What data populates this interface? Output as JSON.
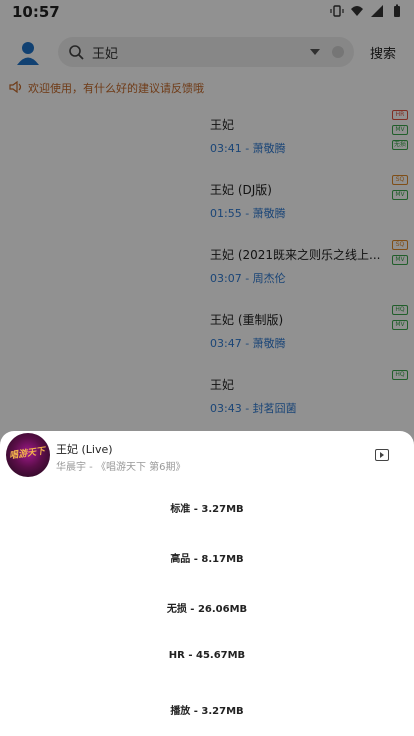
{
  "status": {
    "time": "10:57"
  },
  "header": {
    "search_value": "王妃",
    "search_button": "搜索"
  },
  "notice": {
    "text": "欢迎使用，有什么好的建议请反馈哦"
  },
  "songs": [
    {
      "title": "王妃",
      "subtitle": "03:41 - 萧敬腾",
      "badges": [
        {
          "label": "HR",
          "color": "#e0523f"
        },
        {
          "label": "MV",
          "color": "#3aa64c"
        },
        {
          "label": "无损",
          "color": "#3aa64c"
        }
      ]
    },
    {
      "title": "王妃 (DJ版)",
      "subtitle": "01:55 - 萧敬腾",
      "badges": [
        {
          "label": "SQ",
          "color": "#e08a2a"
        },
        {
          "label": "MV",
          "color": "#3aa64c"
        }
      ]
    },
    {
      "title": "王妃 (2021既来之则乐之线上...",
      "subtitle": "03:07 - 周杰伦",
      "badges": [
        {
          "label": "SQ",
          "color": "#e08a2a"
        },
        {
          "label": "MV",
          "color": "#3aa64c"
        }
      ]
    },
    {
      "title": "王妃 (重制版)",
      "subtitle": "03:47 - 萧敬腾",
      "badges": [
        {
          "label": "HQ",
          "color": "#3aa64c"
        },
        {
          "label": "MV",
          "color": "#3aa64c"
        }
      ]
    },
    {
      "title": "王妃",
      "subtitle": "03:43 - 封茗囧菌",
      "badges": [
        {
          "label": "HQ",
          "color": "#3aa64c"
        }
      ]
    }
  ],
  "sheet": {
    "title": "王妃 (Live)",
    "subtitle": "华晨宇 - 《唱游天下 第6期》",
    "album_text": "唱游天下",
    "options": [
      {
        "label": "标准 - 3.27MB"
      },
      {
        "label": "高品 - 8.17MB"
      },
      {
        "label": "无损 - 26.06MB"
      },
      {
        "label": "HR - 45.67MB"
      },
      {
        "label": "播放 - 3.27MB"
      }
    ]
  }
}
